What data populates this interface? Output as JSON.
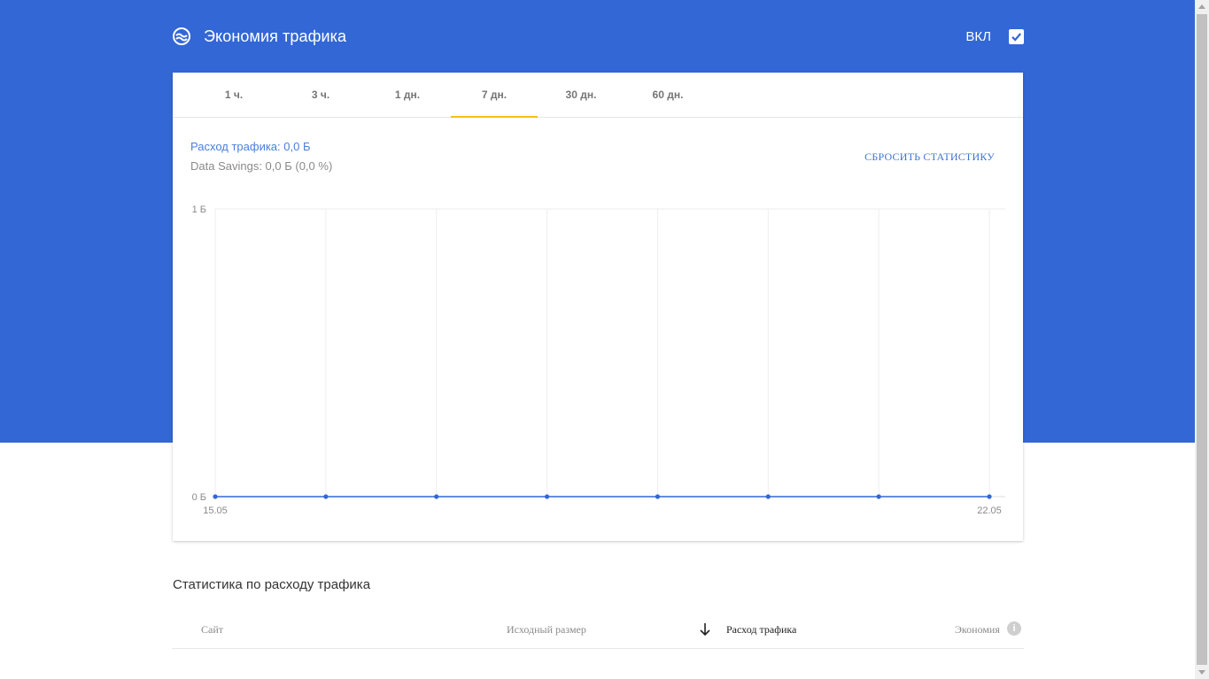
{
  "header": {
    "title": "Экономия трафика",
    "icon": "data-saver-icon",
    "toggle_label": "ВКЛ",
    "toggle_checked": true
  },
  "tabs": [
    {
      "label": "1 ч.",
      "active": false
    },
    {
      "label": "3 ч.",
      "active": false
    },
    {
      "label": "1 дн.",
      "active": false
    },
    {
      "label": "7 дн.",
      "active": true
    },
    {
      "label": "30 дн.",
      "active": false
    },
    {
      "label": "60 дн.",
      "active": false
    }
  ],
  "summary": {
    "usage": "Расход трафика: 0,0 Б",
    "savings": "Data Savings: 0,0 Б (0,0 %)",
    "reset_label": "СБРОСИТЬ СТАТИСТИКУ"
  },
  "chart_data": {
    "type": "line",
    "y_tick_labels": [
      "1 Б",
      "0 Б"
    ],
    "ylim": [
      0,
      1
    ],
    "x_tick_labels": [
      "15.05",
      "22.05"
    ],
    "x": [
      "15.05",
      "16.05",
      "17.05",
      "18.05",
      "19.05",
      "20.05",
      "21.05",
      "22.05"
    ],
    "series": [
      {
        "values": [
          0,
          0,
          0,
          0,
          0,
          0,
          0,
          0
        ],
        "color": "#3367d6"
      }
    ],
    "grid": true
  },
  "stats": {
    "title": "Статистика по расходу трафика",
    "columns": {
      "site": "Сайт",
      "original": "Исходный размер",
      "usage": "Расход трафика",
      "savings": "Экономия"
    },
    "sort_icon": "arrow-down-icon",
    "info_icon": "info-icon"
  },
  "colors": {
    "brand": "#3367d6",
    "tab_indicator": "#f4c20d",
    "link": "#3f73cf"
  }
}
